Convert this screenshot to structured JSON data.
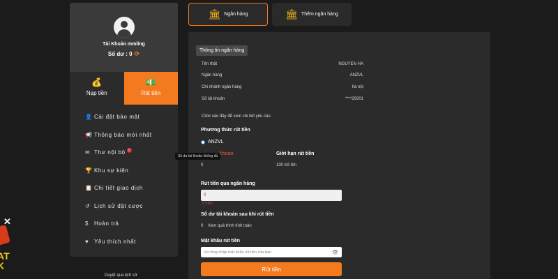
{
  "sidebar": {
    "account_name": "Tài Khoản mmling",
    "balance_label": "Số dư : 0",
    "deposit_label": "Nạp tiền",
    "withdraw_label": "Rút tiền",
    "items": [
      {
        "label": "Cài đặt bảo mật",
        "icon": "user-lock-icon"
      },
      {
        "label": "Thông báo mới nhất",
        "icon": "megaphone-icon"
      },
      {
        "label": "Thư nội bộ",
        "icon": "envelope-icon",
        "badge": "2"
      },
      {
        "label": "Khu sự kiện",
        "icon": "trophy-icon"
      },
      {
        "label": "Chi tiết giao dịch",
        "icon": "clipboard-icon"
      },
      {
        "label": "Lịch sử đặt cược",
        "icon": "history-icon"
      },
      {
        "label": "Hoàn trả",
        "icon": "dollar-circle-icon"
      },
      {
        "label": "Yêu thích nhất",
        "icon": "heart-icon"
      }
    ]
  },
  "tabs": {
    "bank": "Ngân hàng",
    "add_bank": "Thêm ngân hàng"
  },
  "bank_info": {
    "title": "Thông tin ngân hàng",
    "rows": [
      {
        "label": "Tên thật",
        "value": "NGUYEN HA"
      },
      {
        "label": "Ngân hàng",
        "value": "ANZVL"
      },
      {
        "label": "Chi nhánh ngân hàng",
        "value": "hà nội"
      },
      {
        "label": "Số tài khoản",
        "value": "****29201"
      }
    ],
    "detail_link": "Click vào đây để xem chi tiết yêu cầu"
  },
  "withdraw": {
    "method_label": "Phương thức rút tiền",
    "method_value": "ANZVL",
    "balance_label_partial": "khoản",
    "balance_value": "0",
    "limit_label": "Giới hạn rút tiền",
    "limit_value": "100 trở lên",
    "amount_label": "Rút tiền qua ngân hàng",
    "amount_value": "0",
    "currency": "0 VND",
    "after_label": "Số dư tài khoản sau khi rút tiền",
    "after_value": "0",
    "after_detail": "Xem quá trình tính toán",
    "password_label": "Mật khẩu rút tiền",
    "password_placeholder": "Vui lòng nhập mật khẩu rút tiền của bạn",
    "submit_label": "Rút tiền"
  },
  "tooltip": "Số dư tài khoản không đủ",
  "footer_link": "Duyệt qua lịch sử",
  "promo_text": "AT\nK",
  "colors": {
    "accent": "#f47a1f",
    "background": "#1b1b1b",
    "panel": "#2b2b2b"
  }
}
